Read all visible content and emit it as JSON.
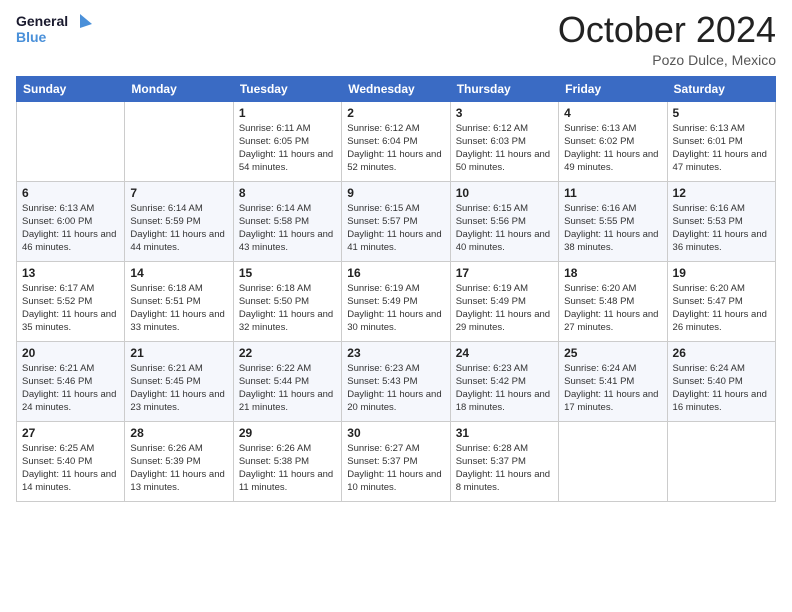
{
  "header": {
    "logo_line1": "General",
    "logo_line2": "Blue",
    "month": "October 2024",
    "location": "Pozo Dulce, Mexico"
  },
  "weekdays": [
    "Sunday",
    "Monday",
    "Tuesday",
    "Wednesday",
    "Thursday",
    "Friday",
    "Saturday"
  ],
  "weeks": [
    [
      {
        "day": "",
        "info": ""
      },
      {
        "day": "",
        "info": ""
      },
      {
        "day": "1",
        "info": "Sunrise: 6:11 AM\nSunset: 6:05 PM\nDaylight: 11 hours and 54 minutes."
      },
      {
        "day": "2",
        "info": "Sunrise: 6:12 AM\nSunset: 6:04 PM\nDaylight: 11 hours and 52 minutes."
      },
      {
        "day": "3",
        "info": "Sunrise: 6:12 AM\nSunset: 6:03 PM\nDaylight: 11 hours and 50 minutes."
      },
      {
        "day": "4",
        "info": "Sunrise: 6:13 AM\nSunset: 6:02 PM\nDaylight: 11 hours and 49 minutes."
      },
      {
        "day": "5",
        "info": "Sunrise: 6:13 AM\nSunset: 6:01 PM\nDaylight: 11 hours and 47 minutes."
      }
    ],
    [
      {
        "day": "6",
        "info": "Sunrise: 6:13 AM\nSunset: 6:00 PM\nDaylight: 11 hours and 46 minutes."
      },
      {
        "day": "7",
        "info": "Sunrise: 6:14 AM\nSunset: 5:59 PM\nDaylight: 11 hours and 44 minutes."
      },
      {
        "day": "8",
        "info": "Sunrise: 6:14 AM\nSunset: 5:58 PM\nDaylight: 11 hours and 43 minutes."
      },
      {
        "day": "9",
        "info": "Sunrise: 6:15 AM\nSunset: 5:57 PM\nDaylight: 11 hours and 41 minutes."
      },
      {
        "day": "10",
        "info": "Sunrise: 6:15 AM\nSunset: 5:56 PM\nDaylight: 11 hours and 40 minutes."
      },
      {
        "day": "11",
        "info": "Sunrise: 6:16 AM\nSunset: 5:55 PM\nDaylight: 11 hours and 38 minutes."
      },
      {
        "day": "12",
        "info": "Sunrise: 6:16 AM\nSunset: 5:53 PM\nDaylight: 11 hours and 36 minutes."
      }
    ],
    [
      {
        "day": "13",
        "info": "Sunrise: 6:17 AM\nSunset: 5:52 PM\nDaylight: 11 hours and 35 minutes."
      },
      {
        "day": "14",
        "info": "Sunrise: 6:18 AM\nSunset: 5:51 PM\nDaylight: 11 hours and 33 minutes."
      },
      {
        "day": "15",
        "info": "Sunrise: 6:18 AM\nSunset: 5:50 PM\nDaylight: 11 hours and 32 minutes."
      },
      {
        "day": "16",
        "info": "Sunrise: 6:19 AM\nSunset: 5:49 PM\nDaylight: 11 hours and 30 minutes."
      },
      {
        "day": "17",
        "info": "Sunrise: 6:19 AM\nSunset: 5:49 PM\nDaylight: 11 hours and 29 minutes."
      },
      {
        "day": "18",
        "info": "Sunrise: 6:20 AM\nSunset: 5:48 PM\nDaylight: 11 hours and 27 minutes."
      },
      {
        "day": "19",
        "info": "Sunrise: 6:20 AM\nSunset: 5:47 PM\nDaylight: 11 hours and 26 minutes."
      }
    ],
    [
      {
        "day": "20",
        "info": "Sunrise: 6:21 AM\nSunset: 5:46 PM\nDaylight: 11 hours and 24 minutes."
      },
      {
        "day": "21",
        "info": "Sunrise: 6:21 AM\nSunset: 5:45 PM\nDaylight: 11 hours and 23 minutes."
      },
      {
        "day": "22",
        "info": "Sunrise: 6:22 AM\nSunset: 5:44 PM\nDaylight: 11 hours and 21 minutes."
      },
      {
        "day": "23",
        "info": "Sunrise: 6:23 AM\nSunset: 5:43 PM\nDaylight: 11 hours and 20 minutes."
      },
      {
        "day": "24",
        "info": "Sunrise: 6:23 AM\nSunset: 5:42 PM\nDaylight: 11 hours and 18 minutes."
      },
      {
        "day": "25",
        "info": "Sunrise: 6:24 AM\nSunset: 5:41 PM\nDaylight: 11 hours and 17 minutes."
      },
      {
        "day": "26",
        "info": "Sunrise: 6:24 AM\nSunset: 5:40 PM\nDaylight: 11 hours and 16 minutes."
      }
    ],
    [
      {
        "day": "27",
        "info": "Sunrise: 6:25 AM\nSunset: 5:40 PM\nDaylight: 11 hours and 14 minutes."
      },
      {
        "day": "28",
        "info": "Sunrise: 6:26 AM\nSunset: 5:39 PM\nDaylight: 11 hours and 13 minutes."
      },
      {
        "day": "29",
        "info": "Sunrise: 6:26 AM\nSunset: 5:38 PM\nDaylight: 11 hours and 11 minutes."
      },
      {
        "day": "30",
        "info": "Sunrise: 6:27 AM\nSunset: 5:37 PM\nDaylight: 11 hours and 10 minutes."
      },
      {
        "day": "31",
        "info": "Sunrise: 6:28 AM\nSunset: 5:37 PM\nDaylight: 11 hours and 8 minutes."
      },
      {
        "day": "",
        "info": ""
      },
      {
        "day": "",
        "info": ""
      }
    ]
  ]
}
